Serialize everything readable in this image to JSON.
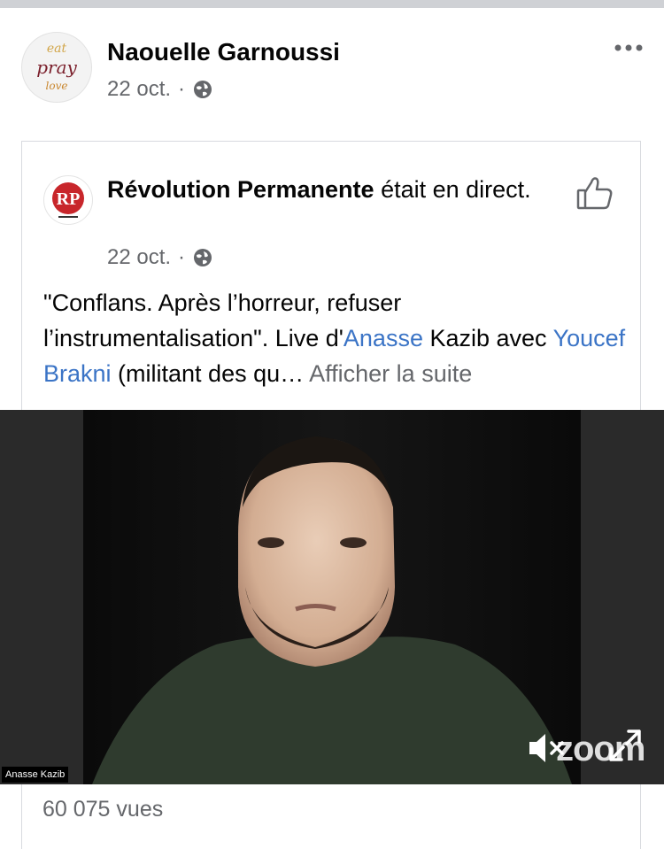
{
  "post": {
    "author_name": "Naouelle Garnoussi",
    "date": "22 oct.",
    "separator": "·",
    "avatar_text": {
      "line1": "eat",
      "line2": "pray",
      "line3": "love"
    },
    "more_icon": "more-horizontal-icon",
    "privacy_icon": "globe-icon"
  },
  "shared": {
    "page_name": "Révolution Permanente",
    "status_text": " était en direct.",
    "date": "22 oct.",
    "separator": "·",
    "like_icon": "thumbs-up-icon",
    "text_part1": "\"Conflans. Après l’horreur, refuser l’instrumentalisation\". Live d'",
    "link1": "Anasse",
    "text_part2": " Kazib avec ",
    "link2": "Youcef Brakni",
    "text_part3": " (militant des qu… ",
    "see_more": "Afficher la suite"
  },
  "video": {
    "participant_name": "Anasse Kazib",
    "watermark": "zoom",
    "mute_icon": "speaker-muted-icon",
    "expand_icon": "expand-icon"
  },
  "stats": {
    "views": "60 075 vues"
  },
  "colors": {
    "link": "#3b74c6",
    "secondary_text": "#65676b",
    "brand_red": "#c8262b"
  }
}
